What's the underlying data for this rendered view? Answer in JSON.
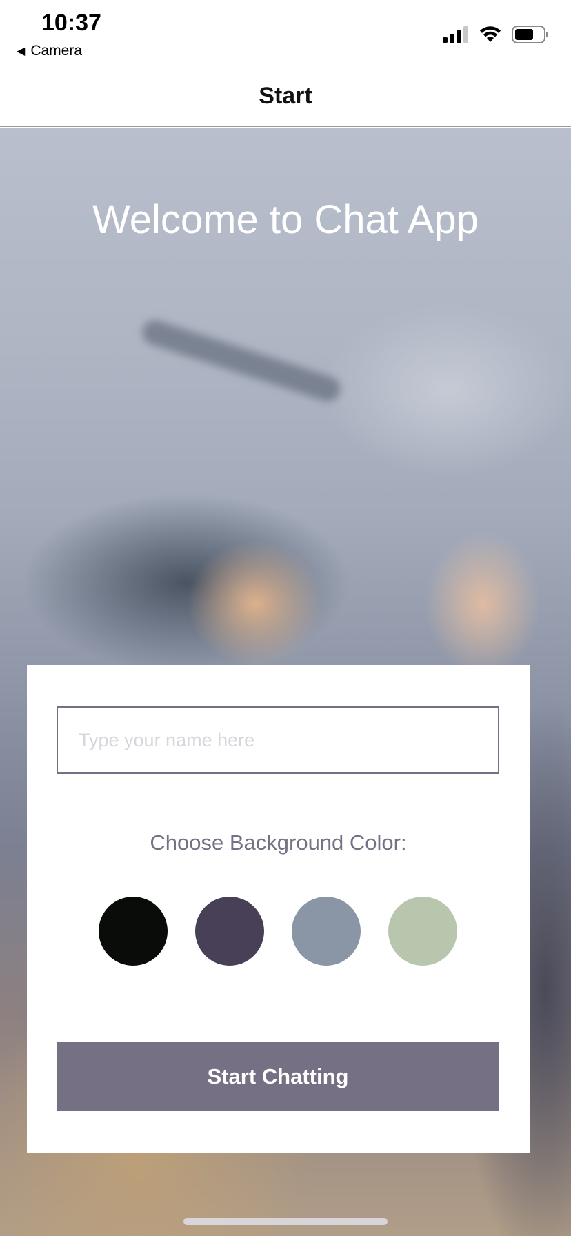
{
  "status_bar": {
    "time": "10:37",
    "back_app": "Camera",
    "icons": [
      "cellular-signal-icon",
      "wifi-icon",
      "battery-icon"
    ]
  },
  "nav": {
    "title": "Start"
  },
  "hero": {
    "welcome": "Welcome to Chat App"
  },
  "form": {
    "name_placeholder": "Type your name here",
    "name_value": "",
    "color_label": "Choose Background Color:",
    "colors": [
      "#090C08",
      "#474056",
      "#8A95A5",
      "#B9C6AE"
    ],
    "button_label": "Start Chatting",
    "button_color": "#757083"
  }
}
